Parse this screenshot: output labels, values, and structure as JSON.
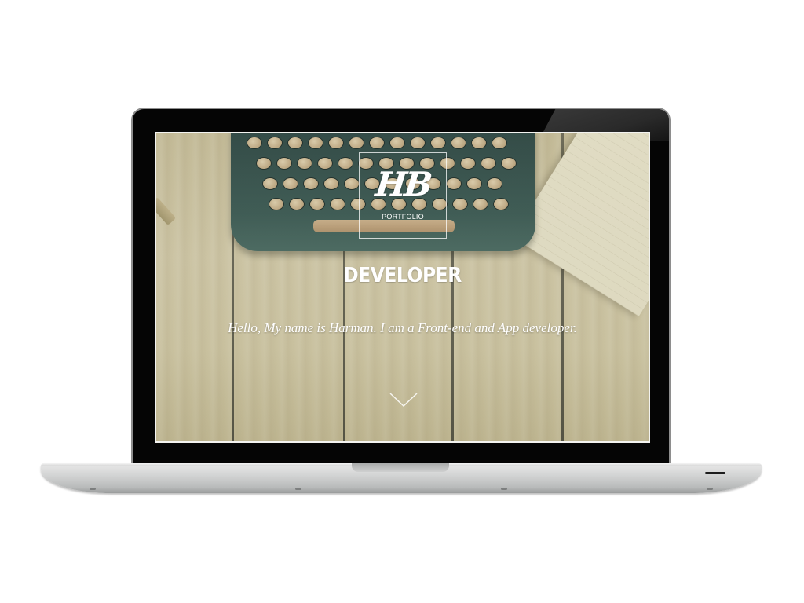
{
  "site": {
    "logo": {
      "mark": "HB",
      "subtitle": "PORTFOLIO"
    },
    "hero": {
      "headline": "DEVELOPER",
      "tagline": "Hello, My name is Harman. I am a Front-end and App developer."
    },
    "scroll_icon": "chevron-down-icon"
  },
  "colors": {
    "bezel": "#050505",
    "text": "#ffffff",
    "wood": "#d6caa6",
    "typewriter": "#3c5a55",
    "aluminum": "#d3d4d4"
  }
}
